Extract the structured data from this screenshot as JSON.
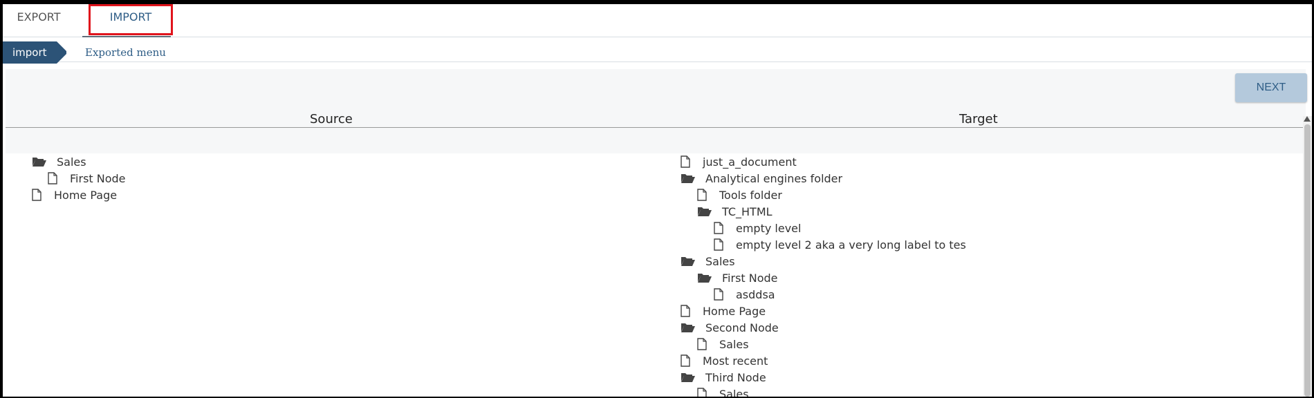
{
  "tabs": {
    "export_label": "EXPORT",
    "import_label": "IMPORT"
  },
  "breadcrumb": {
    "current": "import",
    "next": "Exported menu"
  },
  "actions": {
    "next_label": "NEXT"
  },
  "columns": {
    "source": "Source",
    "target": "Target"
  },
  "source_tree": [
    {
      "label": "Sales",
      "type": "folder-open",
      "depth": 0
    },
    {
      "label": "First Node",
      "type": "document",
      "depth": 1
    },
    {
      "label": "Home Page",
      "type": "document",
      "depth": 0
    }
  ],
  "target_tree": [
    {
      "label": "just_a_document",
      "type": "document",
      "depth": 0
    },
    {
      "label": "Analytical engines folder",
      "type": "folder-open",
      "depth": 0
    },
    {
      "label": "Tools folder",
      "type": "document",
      "depth": 1
    },
    {
      "label": "TC_HTML",
      "type": "folder-open",
      "depth": 1
    },
    {
      "label": "empty level",
      "type": "document",
      "depth": 2
    },
    {
      "label": "empty level 2 aka a very long label to tes",
      "type": "document",
      "depth": 2
    },
    {
      "label": "Sales",
      "type": "folder-open",
      "depth": 0
    },
    {
      "label": "First Node",
      "type": "folder-open",
      "depth": 1
    },
    {
      "label": "asddsa",
      "type": "document",
      "depth": 2
    },
    {
      "label": "Home Page",
      "type": "document",
      "depth": 0
    },
    {
      "label": "Second Node",
      "type": "folder-open",
      "depth": 0
    },
    {
      "label": "Sales",
      "type": "document",
      "depth": 1
    },
    {
      "label": "Most recent",
      "type": "document",
      "depth": 0
    },
    {
      "label": "Third Node",
      "type": "folder-open",
      "depth": 0
    },
    {
      "label": "Sales",
      "type": "document",
      "depth": 1
    }
  ],
  "colors": {
    "accent": "#2c5377",
    "highlight_border": "#e0141c",
    "next_button_bg": "#b4c9dc"
  }
}
